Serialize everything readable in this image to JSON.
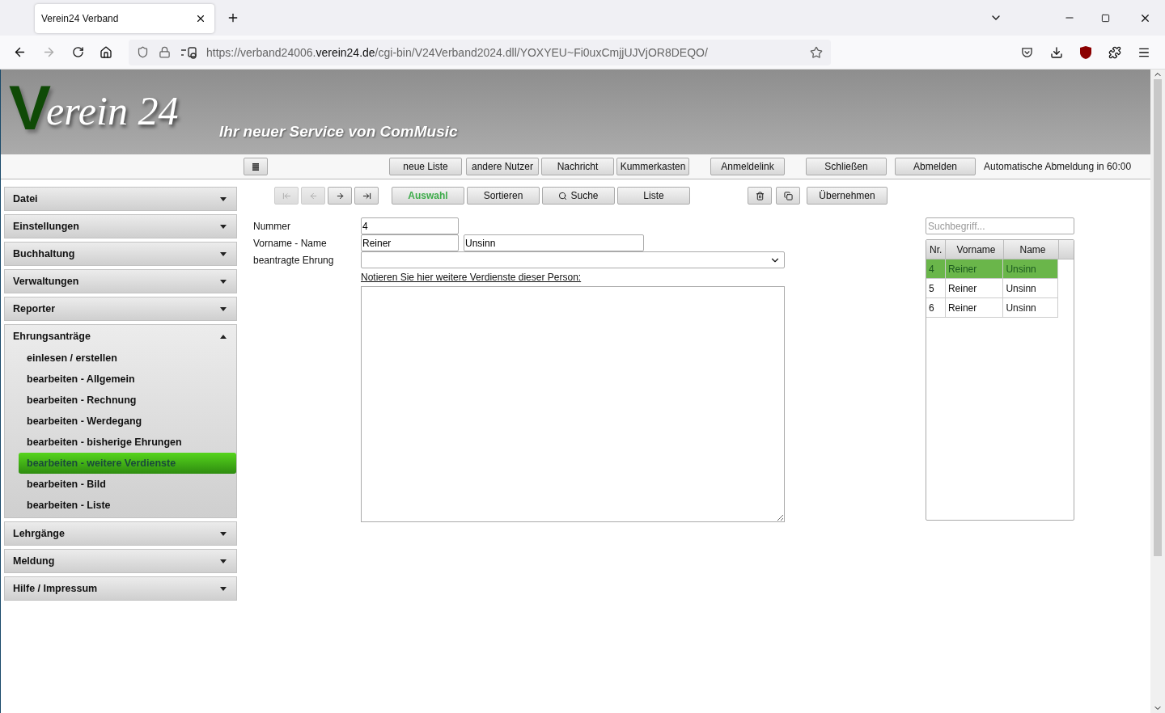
{
  "browser": {
    "tabs": [
      {
        "title": "Verein24 Verband",
        "selected": true
      }
    ],
    "url": {
      "prefix": "https://verband24006.",
      "domain": "verein24.de",
      "path": "/cgi-bin/V24Verband2024.dll/YOXYEU~Fi0uxCmjjUJVjOR8DEQO/"
    }
  },
  "header": {
    "logo_initial": "V",
    "logo_rest": "erein 24",
    "slogan": "Ihr neuer Service von ComMusic"
  },
  "top_bar": {
    "buttons": [
      {
        "kind": "icon"
      },
      {
        "kind": "text",
        "label": "neue Liste"
      },
      {
        "kind": "text",
        "label": "andere Nutzer"
      },
      {
        "kind": "text",
        "label": "Nachricht"
      },
      {
        "kind": "text",
        "label": "Kummerkasten"
      },
      {
        "kind": "text",
        "label": "Anmeldelink"
      },
      {
        "kind": "text",
        "label": "Schließen"
      },
      {
        "kind": "text",
        "label": "Abmelden"
      }
    ],
    "logout_notice": "Automatische Abmeldung in 60:00"
  },
  "sidebar": {
    "sections": [
      {
        "label": "Datei",
        "expanded": false
      },
      {
        "label": "Einstellungen",
        "expanded": false
      },
      {
        "label": "Buchhaltung",
        "expanded": false
      },
      {
        "label": "Verwaltungen",
        "expanded": false
      },
      {
        "label": "Reporter",
        "expanded": false
      },
      {
        "label": "Ehrungsanträge",
        "expanded": true,
        "items": [
          {
            "label": "einlesen / erstellen",
            "selected": false
          },
          {
            "label": "bearbeiten - Allgemein",
            "selected": false
          },
          {
            "label": "bearbeiten - Rechnung",
            "selected": false
          },
          {
            "label": "bearbeiten - Werdegang",
            "selected": false
          },
          {
            "label": "bearbeiten - bisherige Ehrungen",
            "selected": false
          },
          {
            "label": "bearbeiten - weitere Verdienste",
            "selected": true
          },
          {
            "label": "bearbeiten - Bild",
            "selected": false
          },
          {
            "label": "bearbeiten - Liste",
            "selected": false
          }
        ]
      },
      {
        "label": "Lehrgänge",
        "expanded": false
      },
      {
        "label": "Meldung",
        "expanded": false
      },
      {
        "label": "Hilfe / Impressum",
        "expanded": false
      }
    ]
  },
  "toolbar": {
    "buttons": [
      {
        "kind": "first",
        "disabled": true
      },
      {
        "kind": "prev",
        "disabled": true
      },
      {
        "kind": "next",
        "disabled": false
      },
      {
        "kind": "last",
        "disabled": false
      },
      {
        "kind": "text",
        "label": "Auswahl",
        "selected": true
      },
      {
        "kind": "text",
        "label": "Sortieren",
        "selected": false
      },
      {
        "kind": "search",
        "label": "Suche",
        "selected": false
      },
      {
        "kind": "text",
        "label": "Liste",
        "selected": false
      },
      {
        "kind": "delete",
        "disabled": false
      },
      {
        "kind": "copy",
        "disabled": false
      },
      {
        "kind": "text",
        "label": "Übernehmen",
        "selected": false
      }
    ]
  },
  "form": {
    "nummer_label": "Nummer",
    "nummer": "4",
    "name_label": "Vorname - Name",
    "vorname": "Reiner",
    "name": "Unsinn",
    "ehrung_label": "beantragte Ehrung",
    "notes_link": "Notieren Sie hier weitere Verdienste dieser Person:"
  },
  "list": {
    "search_placeholder": "Suchbegriff...",
    "columns": [
      "Nr.",
      "Vorname",
      "Name"
    ],
    "rows": [
      {
        "cells": [
          "4",
          "Reiner",
          "Unsinn"
        ],
        "selected": true
      },
      {
        "cells": [
          "5",
          "Reiner",
          "Unsinn"
        ],
        "selected": false
      },
      {
        "cells": [
          "6",
          "Reiner",
          "Unsinn"
        ],
        "selected": false
      }
    ]
  }
}
